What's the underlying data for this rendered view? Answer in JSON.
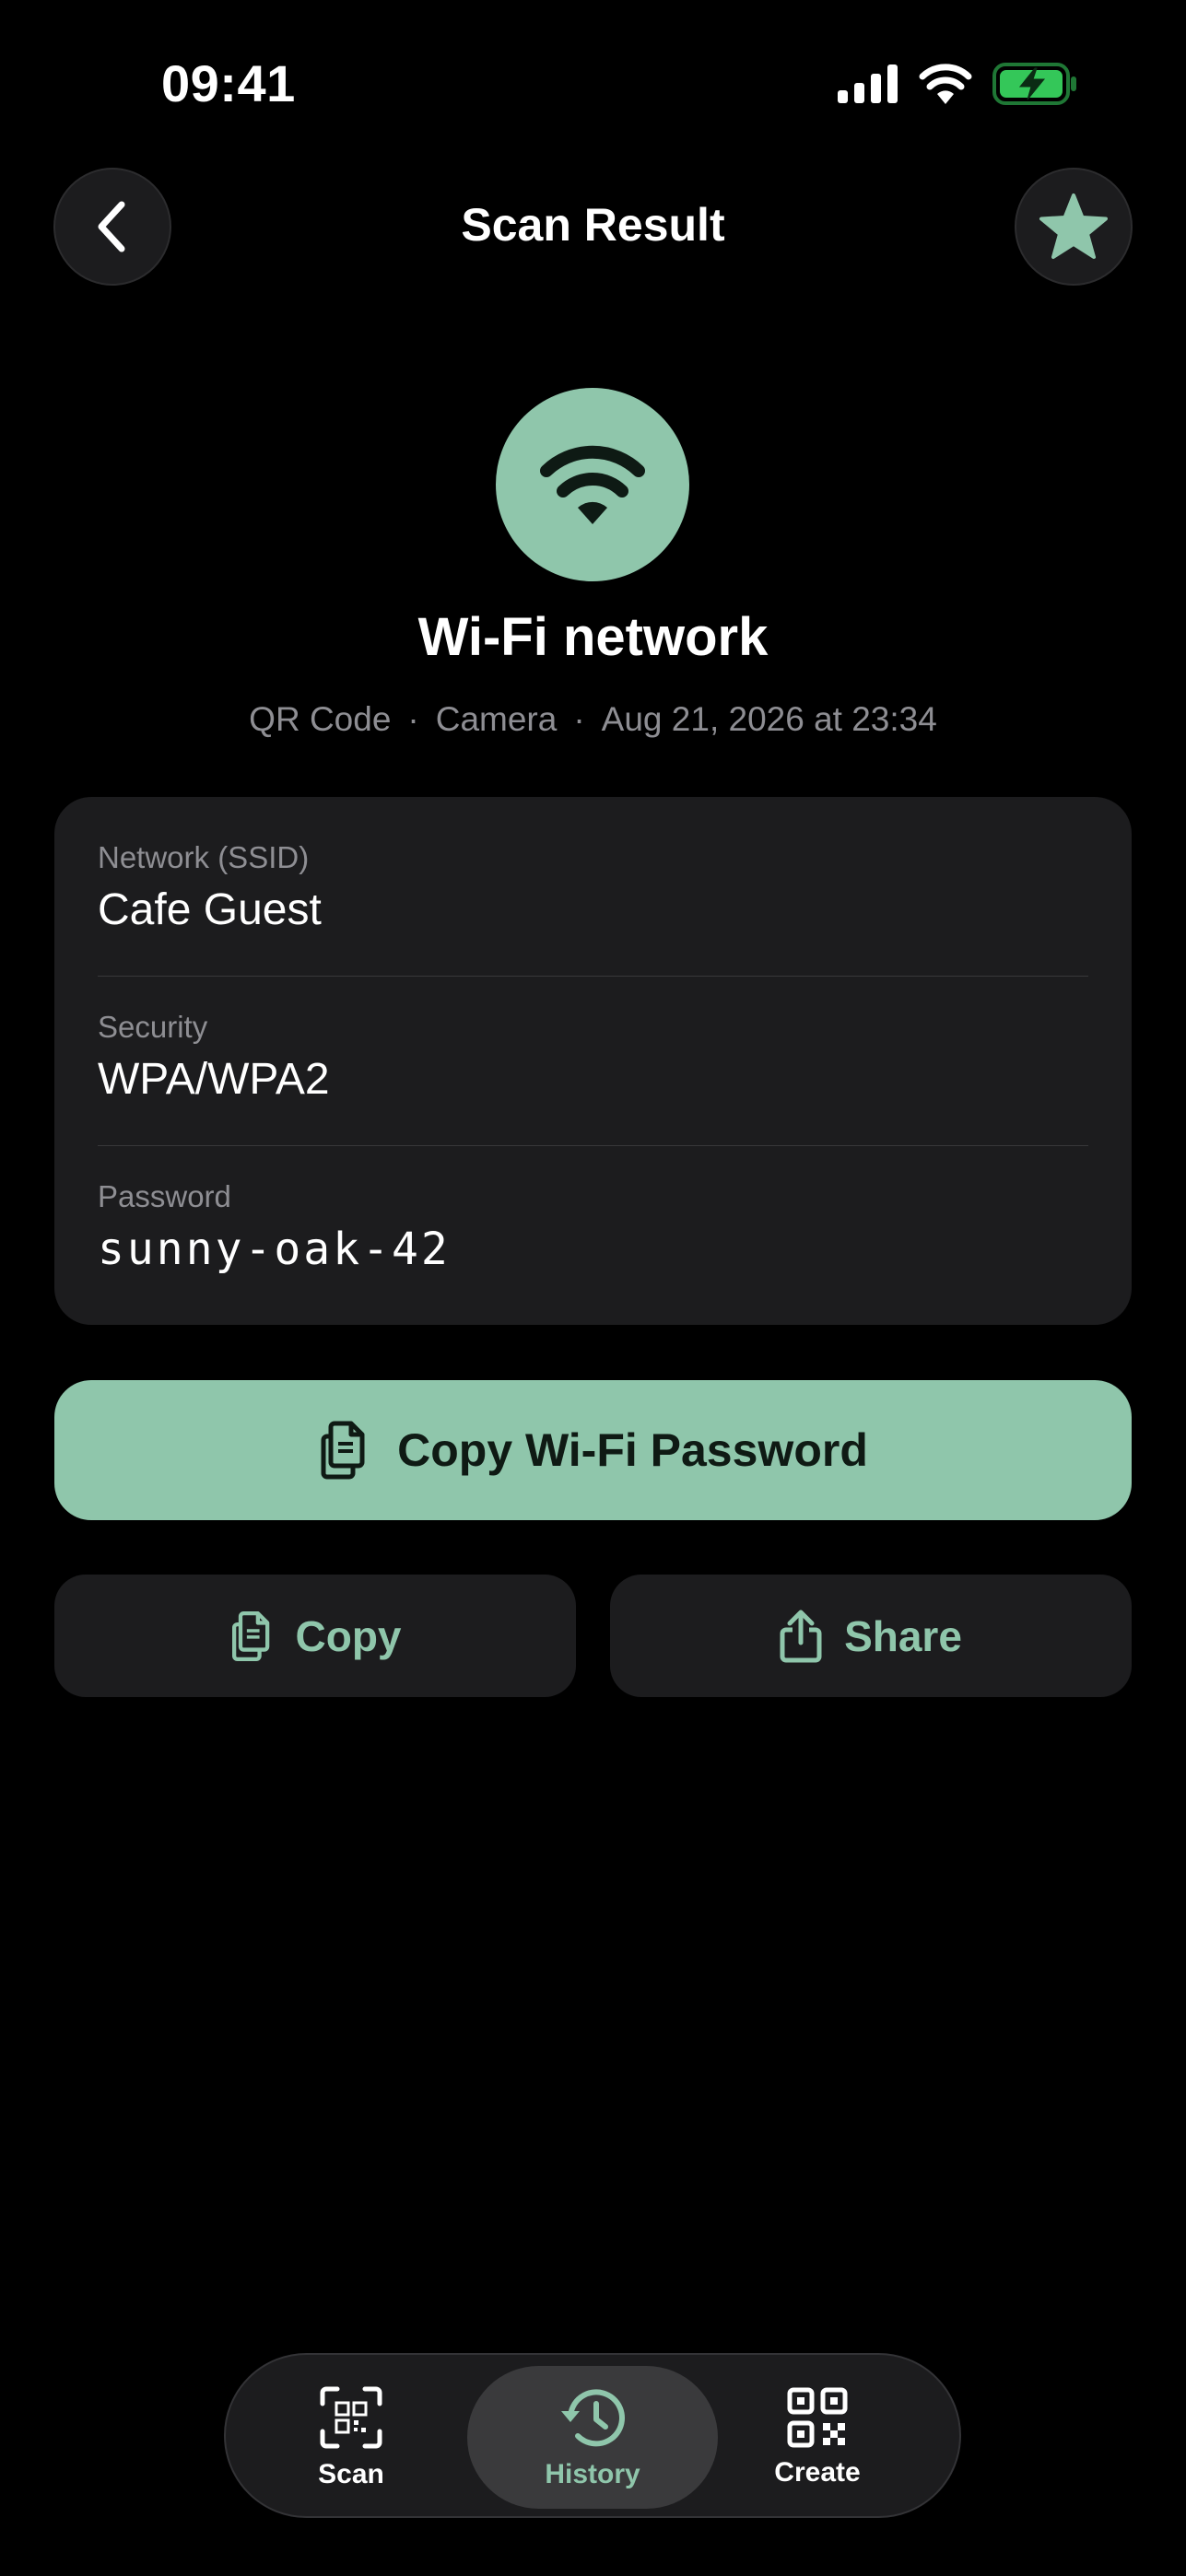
{
  "status_bar": {
    "time": "09:41"
  },
  "nav": {
    "title": "Scan Result"
  },
  "hero": {
    "title": "Wi-Fi network",
    "meta": [
      "QR Code",
      "Camera",
      "Aug 21, 2026 at 23:34"
    ]
  },
  "details": [
    {
      "label": "Network (SSID)",
      "value": "Cafe Guest"
    },
    {
      "label": "Security",
      "value": "WPA/WPA2"
    },
    {
      "label": "Password",
      "value": "sunny-oak-42"
    }
  ],
  "actions": {
    "primary_label": "Copy Wi-Fi Password",
    "copy_label": "Copy",
    "share_label": "Share"
  },
  "tabs": [
    {
      "label": "Scan",
      "icon": "scan-icon",
      "active": false
    },
    {
      "label": "History",
      "icon": "history-icon",
      "active": true
    },
    {
      "label": "Create",
      "icon": "qr-create-icon",
      "active": false
    }
  ],
  "colors": {
    "accent": "#8fc6ab",
    "background": "#000000",
    "card": "#1c1c1e",
    "secondary_text": "#8e8e93",
    "battery": "#34c759"
  }
}
